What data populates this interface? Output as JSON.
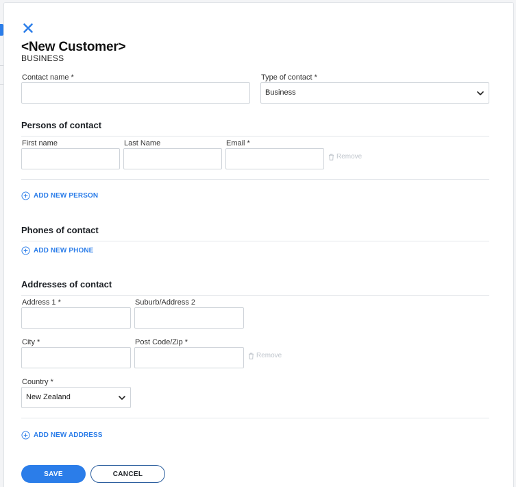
{
  "header": {
    "title": "<New Customer>",
    "subtitle": "BUSINESS"
  },
  "contact": {
    "name_label": "Contact name *",
    "name_value": "",
    "type_label": "Type of contact *",
    "type_value": "Business"
  },
  "persons": {
    "section_title": "Persons of contact",
    "first_name_label": "First name",
    "last_name_label": "Last Name",
    "email_label": "Email *",
    "first_name_value": "",
    "last_name_value": "",
    "email_value": "",
    "remove_label": "Remove",
    "add_label": "ADD NEW PERSON"
  },
  "phones": {
    "section_title": "Phones of contact",
    "add_label": "ADD NEW PHONE"
  },
  "addresses": {
    "section_title": "Addresses of contact",
    "address1_label": "Address 1 *",
    "suburb_label": "Suburb/Address 2",
    "city_label": "City *",
    "postcode_label": "Post Code/Zip *",
    "country_label": "Country *",
    "address1_value": "",
    "suburb_value": "",
    "city_value": "",
    "postcode_value": "",
    "country_value": "New Zealand",
    "remove_label": "Remove",
    "add_label": "ADD NEW ADDRESS"
  },
  "actions": {
    "save_label": "SAVE",
    "cancel_label": "CANCEL"
  },
  "colors": {
    "accent": "#2b7de9",
    "remove_text": "#bfc5cc",
    "border": "#cfd4da"
  },
  "icons": {
    "close": "close-icon",
    "chevron": "chevron-down-icon",
    "add": "plus-circle-icon",
    "remove": "trash-icon"
  }
}
